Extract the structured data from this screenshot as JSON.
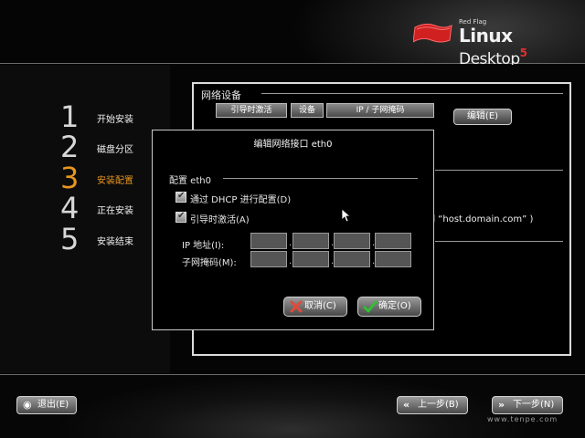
{
  "logo": {
    "small": "Red Flag",
    "brand": "Linux",
    "product": "Desktop",
    "version": "5"
  },
  "steps": [
    {
      "num": "1",
      "label": "开始安装",
      "active": false
    },
    {
      "num": "2",
      "label": "磁盘分区",
      "active": false
    },
    {
      "num": "3",
      "label": "安装配置",
      "active": true
    },
    {
      "num": "4",
      "label": "正在安装",
      "active": false
    },
    {
      "num": "5",
      "label": "安装结束",
      "active": false
    }
  ],
  "network": {
    "group_title": "网络设备",
    "columns": [
      "引导时激活",
      "设备",
      "IP / 子网掩码"
    ],
    "edit_label": "编辑(E)",
    "hostname_hint": "例如 “host.domain.com” )"
  },
  "dialog": {
    "title": "编辑网络接口 eth0",
    "group_title": "配置 eth0",
    "dhcp_label": "通过 DHCP 进行配置(D)",
    "dhcp_checked": true,
    "boot_label": "引导时激活(A)",
    "boot_checked": true,
    "ip_label": "IP 地址(I):",
    "mask_label": "子网掩码(M):",
    "ip_values": [
      "",
      "",
      "",
      ""
    ],
    "mask_values": [
      "",
      "",
      "",
      ""
    ],
    "cancel_label": "取消(C)",
    "ok_label": "确定(O)"
  },
  "footer": {
    "exit_label": "退出(E)",
    "back_label": "上一步(B)",
    "next_label": "下一步(N)",
    "watermark": "www.tenpe.com"
  },
  "colors": {
    "active_step": "#e8961e",
    "cancel_icon": "#e04a3a",
    "ok_icon": "#30c030",
    "logo_flag": "#d02020"
  },
  "icons": {
    "cancel": "x-icon",
    "ok": "checkmark-icon",
    "exit": "power-icon",
    "back": "double-chevron-left-icon",
    "next": "double-chevron-right-icon"
  }
}
